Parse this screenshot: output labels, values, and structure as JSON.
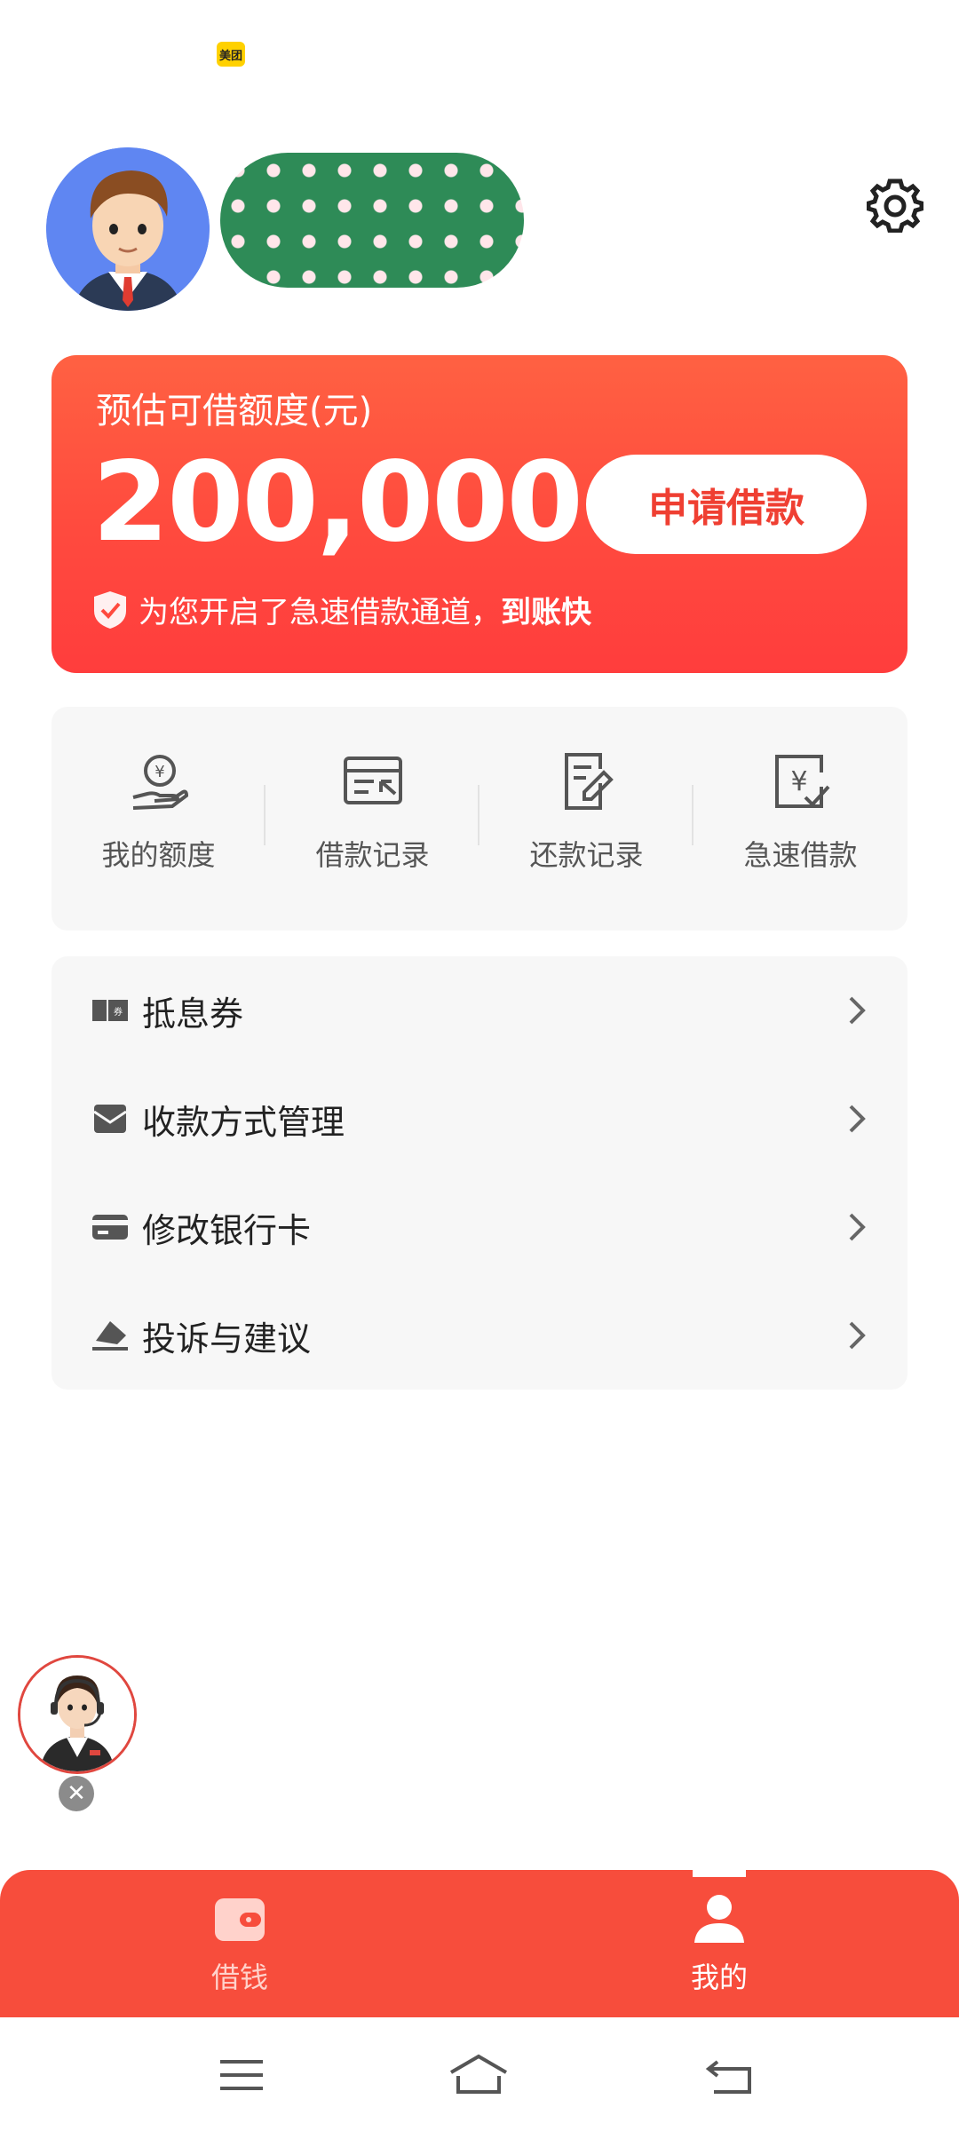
{
  "status_bar": {
    "badge_text": "美团"
  },
  "profile": {
    "avatar_icon": "user-avatar-icon",
    "name_masked": true
  },
  "loan_card": {
    "label": "预估可借额度(元)",
    "amount": "200,000",
    "apply_button": "申请借款",
    "fast_text": "为您开启了急速借款通道，",
    "fast_bold": "到账快",
    "colors": {
      "gradient_top": "#ff6142",
      "gradient_bottom": "#ff3d3d",
      "button_text": "#ef3f32"
    }
  },
  "quick_actions": [
    {
      "label": "我的额度",
      "icon": "yuan-hand-icon"
    },
    {
      "label": "借款记录",
      "icon": "loan-record-icon"
    },
    {
      "label": "还款记录",
      "icon": "repay-record-icon"
    },
    {
      "label": "急速借款",
      "icon": "fast-loan-icon"
    }
  ],
  "menu": [
    {
      "label": "抵息券",
      "icon": "coupon-icon"
    },
    {
      "label": "收款方式管理",
      "icon": "envelope-icon"
    },
    {
      "label": "修改银行卡",
      "icon": "bank-card-icon"
    },
    {
      "label": "投诉与建议",
      "icon": "feedback-icon"
    }
  ],
  "tab_bar": {
    "tabs": [
      {
        "label": "借钱",
        "icon": "wallet-icon",
        "active": false
      },
      {
        "label": "我的",
        "icon": "person-icon",
        "active": true
      }
    ],
    "color": "#f74d3c"
  },
  "floating": {
    "close_glyph": "✕"
  }
}
